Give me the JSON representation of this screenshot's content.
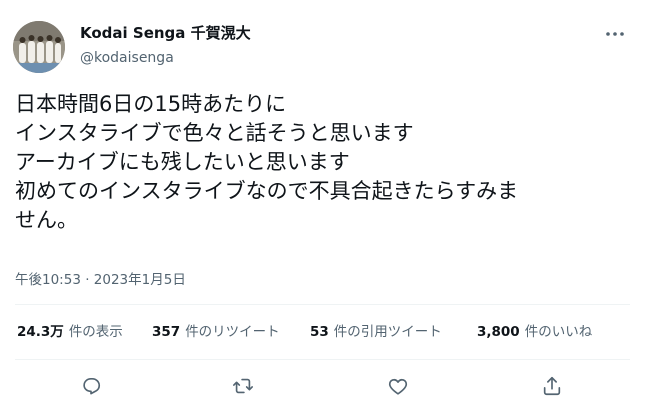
{
  "author": {
    "name": "Kodai Senga 千賀滉大",
    "handle": "@kodaisenga"
  },
  "tweet": {
    "lines": [
      "日本時間6日の15時あたりに",
      "インスタライブで色々と話そうと思います",
      "アーカイブにも残したいと思います",
      "初めてのインスタライブなので不具合起きたらすみま",
      "せん。"
    ],
    "timestamp": "午後10:53 · 2023年1月5日"
  },
  "stats": {
    "views_count": "24.3万",
    "views_label": "件の表示",
    "retweets_count": "357",
    "retweets_label": "件のリツイート",
    "quotes_count": "53",
    "quotes_label": "件の引用ツイート",
    "likes_count": "3,800",
    "likes_label": "件のいいね"
  },
  "icons": {
    "more": "more-icon",
    "reply": "reply-icon",
    "retweet": "retweet-icon",
    "like": "like-icon",
    "share": "share-icon"
  },
  "colors": {
    "text": "#0f1419",
    "secondary": "#536471",
    "divider": "#eff3f4"
  }
}
